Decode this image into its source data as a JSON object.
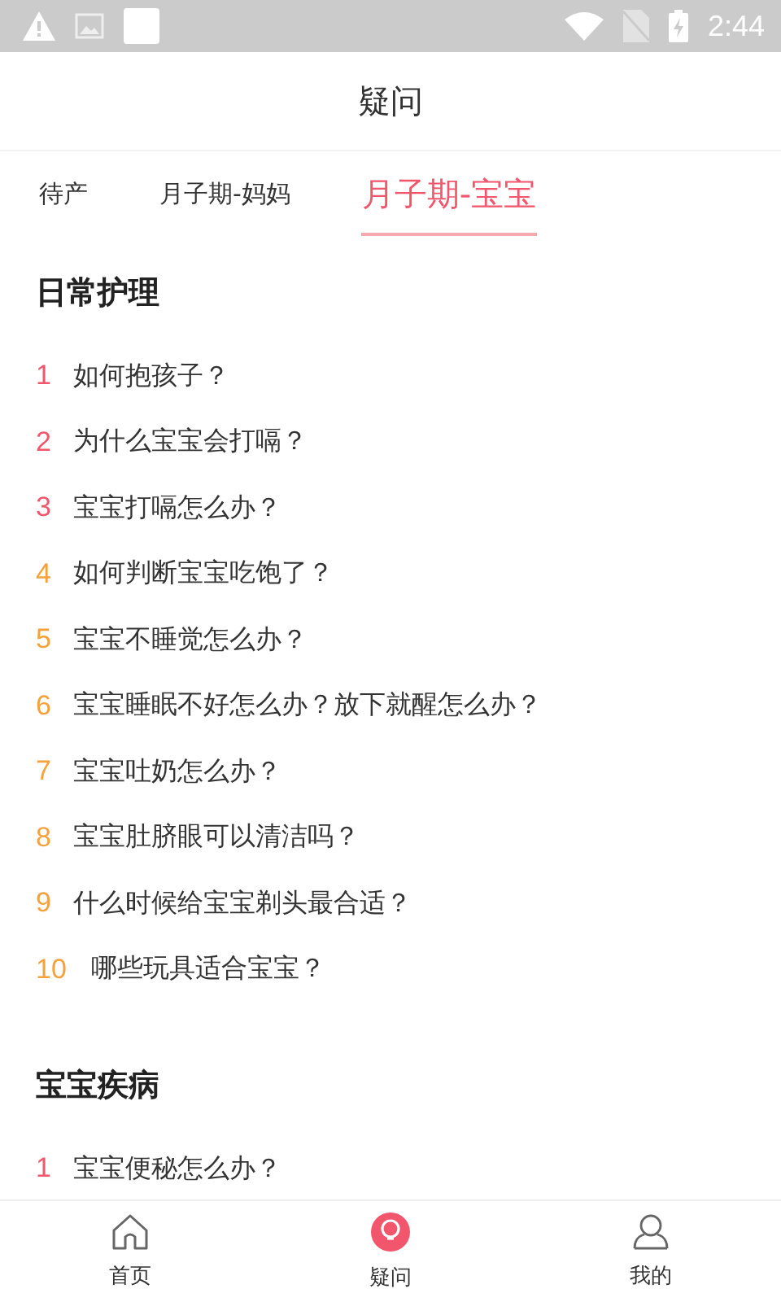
{
  "status_bar": {
    "time": "2:44"
  },
  "header": {
    "title": "疑问"
  },
  "tabs": [
    {
      "label": "待产",
      "selected": false
    },
    {
      "label": "月子期-妈妈",
      "selected": false
    },
    {
      "label": "月子期-宝宝",
      "selected": true
    }
  ],
  "sections": [
    {
      "title": "日常护理",
      "items": [
        {
          "number": "1",
          "color": "#f2566c",
          "text": "如何抱孩子？"
        },
        {
          "number": "2",
          "color": "#f2566c",
          "text": "为什么宝宝会打嗝？"
        },
        {
          "number": "3",
          "color": "#f2566c",
          "text": "宝宝打嗝怎么办？"
        },
        {
          "number": "4",
          "color": "#f5a23c",
          "text": "如何判断宝宝吃饱了？"
        },
        {
          "number": "5",
          "color": "#f5a23c",
          "text": "宝宝不睡觉怎么办？"
        },
        {
          "number": "6",
          "color": "#f5a23c",
          "text": "宝宝睡眠不好怎么办？放下就醒怎么办？"
        },
        {
          "number": "7",
          "color": "#f5a23c",
          "text": "宝宝吐奶怎么办？"
        },
        {
          "number": "8",
          "color": "#f5a23c",
          "text": "宝宝肚脐眼可以清洁吗？"
        },
        {
          "number": "9",
          "color": "#f5a23c",
          "text": "什么时候给宝宝剃头最合适？"
        },
        {
          "number": "10",
          "color": "#f5a23c",
          "text": "哪些玩具适合宝宝？"
        }
      ]
    },
    {
      "title": "宝宝疾病",
      "items": [
        {
          "number": "1",
          "color": "#f2566c",
          "text": "宝宝便秘怎么办？"
        }
      ]
    }
  ],
  "bottom_nav": [
    {
      "label": "首页",
      "kind": "home",
      "selected": false
    },
    {
      "label": "疑问",
      "kind": "question",
      "selected": true
    },
    {
      "label": "我的",
      "kind": "profile",
      "selected": false
    }
  ]
}
